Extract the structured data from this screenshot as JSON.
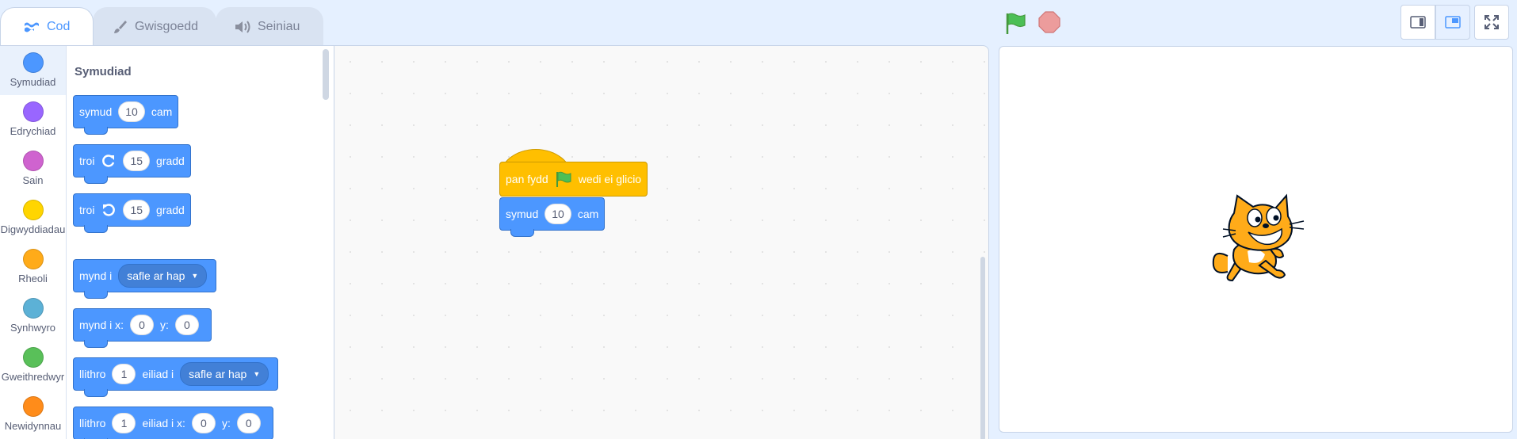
{
  "tabs": [
    {
      "label": "Cod",
      "icon": "code-icon",
      "active": true
    },
    {
      "label": "Gwisgoedd",
      "icon": "costume-brush-icon",
      "active": false
    },
    {
      "label": "Seiniau",
      "icon": "sound-speaker-icon",
      "active": false
    }
  ],
  "categories": [
    {
      "label": "Symudiad",
      "color": "#4c97ff",
      "selected": true
    },
    {
      "label": "Edrychiad",
      "color": "#9966ff"
    },
    {
      "label": "Sain",
      "color": "#cf63cf"
    },
    {
      "label": "Digwyddiadau",
      "color": "#ffd500"
    },
    {
      "label": "Rheoli",
      "color": "#ffab19"
    },
    {
      "label": "Synhwyro",
      "color": "#5cb1d6"
    },
    {
      "label": "Gweithredwyr",
      "color": "#59c059"
    },
    {
      "label": "Newidynnau",
      "color": "#ff8c1a"
    }
  ],
  "palette": {
    "heading": "Symudiad",
    "blocks": {
      "move": {
        "w1": "symud",
        "v1": "10",
        "w2": "cam"
      },
      "turn_right": {
        "w1": "troi",
        "v1": "15",
        "w2": "gradd"
      },
      "turn_left": {
        "w1": "troi",
        "v1": "15",
        "w2": "gradd"
      },
      "goto": {
        "w1": "mynd i",
        "menu": "safle ar hap"
      },
      "goto_xy": {
        "w1": "mynd i x:",
        "x": "0",
        "w2": "y:",
        "y": "0"
      },
      "glide": {
        "w1": "llithro",
        "v1": "1",
        "w2": "eiliad i",
        "menu": "safle ar hap"
      },
      "glide_xy": {
        "w1": "llithro",
        "v1": "1",
        "w2": "eiliad i x:",
        "x": "0",
        "w3": "y:",
        "y": "0"
      }
    }
  },
  "workspace": {
    "hat": {
      "w1": "pan fydd",
      "w2": "wedi ei glicio"
    },
    "move": {
      "w1": "symud",
      "v1": "10",
      "w2": "cam"
    }
  },
  "controls": {
    "green_flag": "green-flag-icon",
    "stop": "stop-icon",
    "view_buttons": [
      "small-stage-icon",
      "normal-stage-icon",
      "fullscreen-icon"
    ]
  },
  "colors": {
    "motion": "#4c97ff",
    "events": "#ffbf00",
    "accent": "#4c97ff"
  }
}
